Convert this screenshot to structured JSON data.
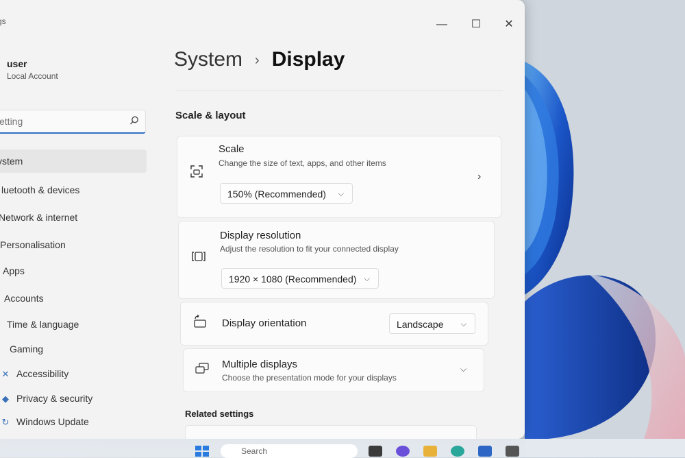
{
  "window": {
    "title": "gs",
    "minimize_glyph": "—",
    "maximize_glyph": "☐",
    "close_glyph": "✕"
  },
  "account": {
    "name": "user",
    "type": "Local Account"
  },
  "search": {
    "placeholder": "etting",
    "icon": "search-icon"
  },
  "nav": {
    "items": [
      {
        "label": "ystem",
        "icon": "system-icon",
        "active": true
      },
      {
        "label": "luetooth & devices",
        "icon": "bluetooth-icon"
      },
      {
        "label": "Network & internet",
        "icon": "network-icon"
      },
      {
        "label": "Personalisation",
        "icon": "brush-icon"
      },
      {
        "label": "Apps",
        "icon": "apps-icon"
      },
      {
        "label": "Accounts",
        "icon": "accounts-icon"
      },
      {
        "label": "Time & language",
        "icon": "clock-icon"
      },
      {
        "label": "Gaming",
        "icon": "gaming-icon"
      },
      {
        "label": "Accessibility",
        "icon": "accessibility-icon"
      },
      {
        "label": "Privacy & security",
        "icon": "shield-icon"
      },
      {
        "label": "Windows Update",
        "icon": "update-icon"
      }
    ]
  },
  "breadcrumb": {
    "root": "System",
    "separator": "›",
    "current": "Display"
  },
  "section_scale_layout": "Scale & layout",
  "scale": {
    "title": "Scale",
    "subtitle": "Change the size of text, apps, and other items",
    "value": "150% (Recommended)"
  },
  "resolution": {
    "title": "Display resolution",
    "subtitle": "Adjust the resolution to fit your connected display",
    "value": "1920 × 1080 (Recommended)"
  },
  "orientation": {
    "title": "Display orientation",
    "value": "Landscape"
  },
  "multiple_displays": {
    "title": "Multiple displays",
    "subtitle": "Choose the presentation mode for your displays"
  },
  "section_related": "Related settings",
  "taskbar": {
    "search_placeholder": "Search"
  },
  "colors": {
    "accent": "#2f6fc4",
    "window_bg": "#f3f3f3",
    "card_bg": "#fbfbfb"
  }
}
